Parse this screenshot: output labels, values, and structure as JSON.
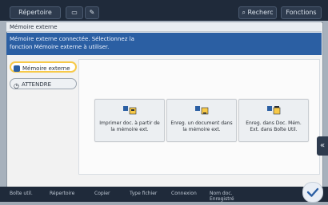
{
  "topbar": {
    "mode_label": "Répertoire",
    "box_tab_label": "",
    "fax_tab_label": "",
    "search_label": "Recherc",
    "functions_label": "Fonctions"
  },
  "header": {
    "title": "Mémoire externe",
    "description_line1": "Mémoire externe connectée. Sélectionnez la",
    "description_line2": "fonction Mémoire externe à utiliser."
  },
  "left_modes": {
    "external_memory": "Mémoire externe",
    "attente": "ATTENDRE"
  },
  "cards": [
    {
      "label": "Imprimer doc. à partir de la mémoire ext."
    },
    {
      "label": "Enreg. un document dans la mémoire ext."
    },
    {
      "label": "Enreg. dans Doc. Mém. Ext. dans Boîte Util."
    }
  ],
  "bottombar": {
    "items": [
      "Boîte util.",
      "Répertoire",
      "Copier",
      "Type fichier",
      "Connexion",
      "Nom doc."
    ],
    "items_line2": [
      "",
      "",
      "",
      "",
      "",
      "Enregistré"
    ],
    "status": "",
    "ok_icon": "check"
  },
  "colors": {
    "topbar": "#1f2a3a",
    "description_bar": "#2b5fa3",
    "highlight": "#f7c948"
  }
}
